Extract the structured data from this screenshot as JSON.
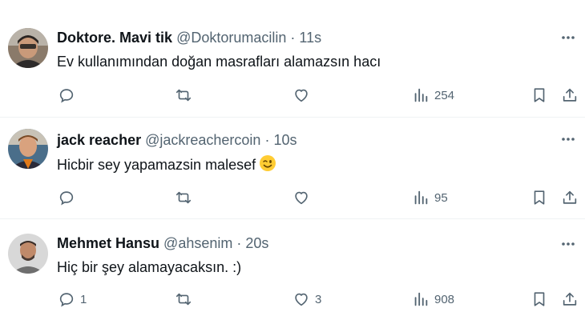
{
  "colors": {
    "text": "#0f1419",
    "secondary": "#536471",
    "divider": "#eff3f4"
  },
  "tweets": [
    {
      "name": "Doktore. Mavi tik",
      "handle": "@Doktorumacilin",
      "dot": "·",
      "time": "11s",
      "text": "Ev kullanımından doğan masrafları alamazsın hacı",
      "emoji": "",
      "replies": "",
      "retweets": "",
      "likes": "",
      "views": "254"
    },
    {
      "name": "jack reacher",
      "handle": "@jackreachercoin",
      "dot": "·",
      "time": "10s",
      "text": "Hicbir sey yapamazsin malesef",
      "emoji": "winking-face",
      "replies": "",
      "retweets": "",
      "likes": "",
      "views": "95"
    },
    {
      "name": "Mehmet Hansu",
      "handle": "@ahsenim",
      "dot": "·",
      "time": "20s",
      "text": "Hiç bir şey alamayacaksın. :)",
      "emoji": "",
      "replies": "1",
      "retweets": "",
      "likes": "3",
      "views": "908"
    }
  ]
}
